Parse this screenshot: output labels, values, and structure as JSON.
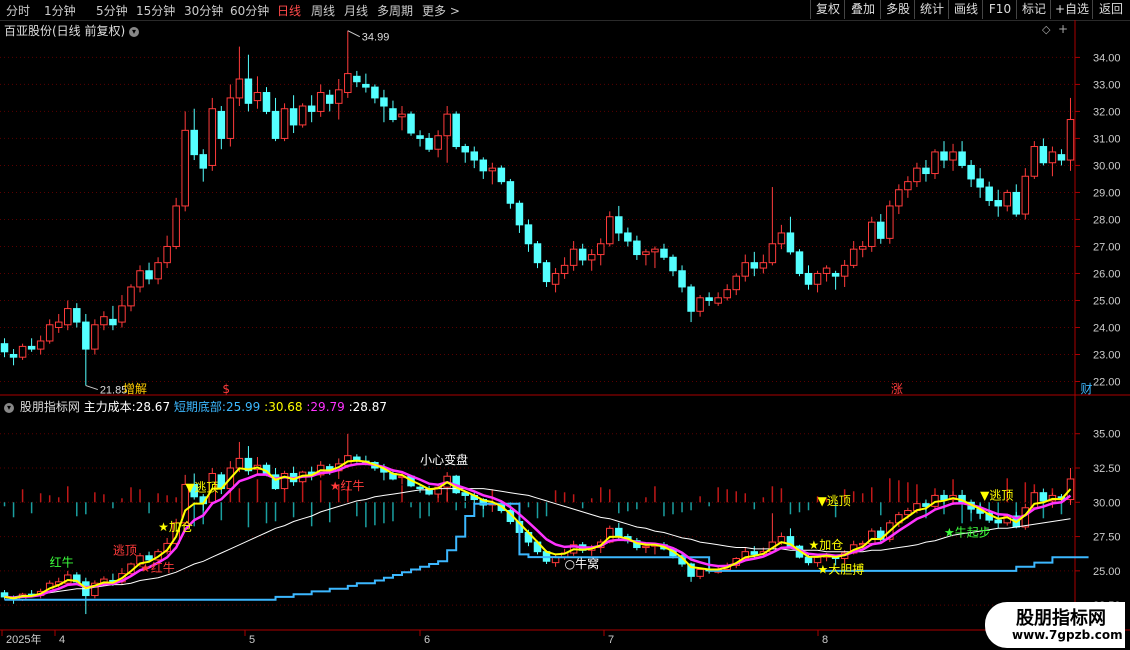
{
  "timeframes": [
    "分时",
    "1分钟",
    "5分钟",
    "15分钟",
    "30分钟",
    "60分钟",
    "日线",
    "周线",
    "月线",
    "多周期",
    "更多"
  ],
  "active_timeframe": "日线",
  "toolbar": [
    "复权",
    "叠加",
    "多股",
    "统计",
    "画线",
    "F10",
    "标记",
    "+自选",
    "返回"
  ],
  "stock_title": "百亚股份(日线 前复权)",
  "indicator": {
    "name": "股朋指标网",
    "main_cost_label": "主力成本:",
    "main_cost": "28.67",
    "short_bottom_label": "短期底部:",
    "short_bottom": "25.99",
    "v3": "30.68",
    "v4": "29.79",
    "v5": "28.87"
  },
  "k_yaxis": [
    "34.00",
    "33.00",
    "32.00",
    "31.00",
    "30.00",
    "29.00",
    "28.00",
    "27.00",
    "26.00",
    "25.00",
    "24.00",
    "23.00",
    "22.00"
  ],
  "ind_yaxis": [
    "35.00",
    "32.50",
    "30.00",
    "27.50",
    "25.00",
    "22.50"
  ],
  "high_label": "34.99",
  "low_label": "21.85",
  "events": [
    "增解",
    "$",
    "涨",
    "财"
  ],
  "annotations": [
    "逃顶",
    "逃顶",
    "加仓",
    "红牛",
    "红牛",
    "小心变盘",
    "牛窝",
    "逃顶",
    "加仓",
    "大胆搏",
    "牛起步",
    "逃顶",
    "红牛"
  ],
  "xaxis": [
    "2025年",
    "4",
    "5",
    "6",
    "7",
    "8"
  ],
  "watermark": {
    "name": "股朋指标网",
    "url": "www.7gpzb.com"
  },
  "colors": {
    "up": "#ff3b3b",
    "down": "#54ffff",
    "cost": "#ffffff",
    "bottom": "#3cb8ff",
    "yellow": "#ffff00",
    "magenta": "#ff33ff"
  },
  "chart_data": {
    "type": "candlestick",
    "ohlc": [
      [
        23.4,
        23.6,
        22.9,
        23.1
      ],
      [
        23.0,
        23.2,
        22.6,
        22.9
      ],
      [
        22.9,
        23.4,
        22.8,
        23.3
      ],
      [
        23.3,
        23.6,
        23.1,
        23.2
      ],
      [
        23.2,
        23.7,
        23.0,
        23.5
      ],
      [
        23.5,
        24.3,
        23.4,
        24.1
      ],
      [
        24.0,
        24.5,
        23.8,
        24.2
      ],
      [
        24.1,
        25.0,
        23.9,
        24.7
      ],
      [
        24.7,
        24.9,
        24.0,
        24.2
      ],
      [
        24.2,
        24.5,
        21.85,
        23.2
      ],
      [
        23.2,
        24.3,
        23.0,
        24.1
      ],
      [
        24.1,
        24.6,
        23.9,
        24.4
      ],
      [
        24.3,
        24.8,
        23.9,
        24.1
      ],
      [
        24.2,
        25.2,
        24.0,
        24.8
      ],
      [
        24.8,
        25.6,
        24.6,
        25.5
      ],
      [
        25.5,
        26.3,
        25.3,
        26.1
      ],
      [
        26.1,
        26.4,
        25.6,
        25.8
      ],
      [
        25.8,
        26.6,
        25.6,
        26.4
      ],
      [
        26.4,
        27.4,
        26.2,
        27.0
      ],
      [
        27.0,
        28.8,
        26.9,
        28.5
      ],
      [
        28.5,
        32.0,
        28.3,
        31.3
      ],
      [
        31.3,
        32.1,
        30.2,
        30.4
      ],
      [
        30.4,
        30.6,
        29.4,
        29.9
      ],
      [
        30.0,
        32.5,
        29.8,
        32.1
      ],
      [
        32.0,
        32.2,
        30.6,
        31.0
      ],
      [
        31.0,
        33.0,
        30.7,
        32.5
      ],
      [
        32.5,
        34.4,
        32.2,
        33.2
      ],
      [
        33.2,
        34.1,
        32.0,
        32.3
      ],
      [
        32.4,
        33.3,
        32.1,
        32.7
      ],
      [
        32.7,
        32.9,
        31.9,
        32.0
      ],
      [
        32.0,
        32.5,
        30.9,
        31.0
      ],
      [
        31.0,
        32.3,
        30.9,
        32.1
      ],
      [
        32.1,
        32.6,
        31.2,
        31.5
      ],
      [
        31.5,
        32.3,
        31.4,
        32.2
      ],
      [
        32.2,
        32.6,
        31.6,
        32.0
      ],
      [
        32.0,
        33.0,
        31.8,
        32.7
      ],
      [
        32.6,
        32.8,
        32.0,
        32.3
      ],
      [
        32.3,
        33.2,
        31.7,
        32.8
      ],
      [
        32.7,
        34.99,
        32.5,
        33.4
      ],
      [
        33.3,
        33.5,
        32.9,
        33.1
      ],
      [
        33.0,
        33.4,
        32.7,
        32.9
      ],
      [
        32.9,
        33.0,
        32.3,
        32.5
      ],
      [
        32.5,
        32.8,
        31.6,
        32.2
      ],
      [
        32.1,
        32.4,
        31.6,
        31.7
      ],
      [
        31.8,
        32.2,
        31.3,
        31.9
      ],
      [
        31.9,
        32.0,
        31.1,
        31.2
      ],
      [
        31.1,
        31.3,
        30.7,
        31.0
      ],
      [
        31.0,
        31.2,
        30.5,
        30.6
      ],
      [
        30.6,
        31.3,
        30.3,
        31.1
      ],
      [
        31.1,
        32.2,
        30.1,
        31.9
      ],
      [
        31.9,
        32.0,
        30.6,
        30.7
      ],
      [
        30.7,
        30.8,
        30.1,
        30.5
      ],
      [
        30.5,
        30.7,
        29.9,
        30.2
      ],
      [
        30.2,
        30.3,
        29.5,
        29.8
      ],
      [
        29.8,
        30.1,
        29.3,
        29.9
      ],
      [
        29.9,
        30.0,
        29.3,
        29.4
      ],
      [
        29.4,
        29.5,
        28.4,
        28.6
      ],
      [
        28.6,
        28.7,
        27.5,
        27.8
      ],
      [
        27.8,
        28.0,
        26.8,
        27.1
      ],
      [
        27.1,
        27.2,
        26.2,
        26.4
      ],
      [
        26.4,
        26.5,
        25.5,
        25.7
      ],
      [
        25.6,
        26.2,
        25.3,
        26.0
      ],
      [
        26.0,
        26.6,
        25.8,
        26.3
      ],
      [
        26.3,
        27.2,
        26.1,
        26.9
      ],
      [
        26.9,
        27.1,
        26.3,
        26.5
      ],
      [
        26.5,
        26.9,
        26.1,
        26.7
      ],
      [
        26.7,
        27.3,
        26.3,
        27.1
      ],
      [
        27.1,
        28.3,
        27.0,
        28.1
      ],
      [
        28.1,
        28.5,
        27.2,
        27.5
      ],
      [
        27.5,
        27.7,
        27.0,
        27.2
      ],
      [
        27.2,
        27.4,
        26.5,
        26.7
      ],
      [
        26.7,
        26.9,
        26.3,
        26.8
      ],
      [
        26.8,
        27.0,
        26.2,
        26.9
      ],
      [
        26.9,
        27.1,
        26.5,
        26.6
      ],
      [
        26.6,
        26.7,
        25.9,
        26.1
      ],
      [
        26.1,
        26.3,
        25.3,
        25.5
      ],
      [
        25.5,
        25.6,
        24.2,
        24.6
      ],
      [
        24.6,
        25.2,
        24.4,
        25.1
      ],
      [
        25.1,
        25.3,
        24.8,
        25.0
      ],
      [
        24.9,
        25.3,
        24.8,
        25.1
      ],
      [
        25.1,
        25.6,
        25.0,
        25.4
      ],
      [
        25.4,
        26.0,
        25.2,
        25.9
      ],
      [
        25.9,
        26.7,
        25.7,
        26.4
      ],
      [
        26.4,
        26.8,
        25.9,
        26.2
      ],
      [
        26.2,
        26.7,
        26.0,
        26.4
      ],
      [
        26.4,
        29.2,
        26.3,
        27.1
      ],
      [
        27.1,
        27.8,
        26.9,
        27.5
      ],
      [
        27.5,
        28.1,
        26.7,
        26.8
      ],
      [
        26.8,
        26.9,
        25.9,
        26.0
      ],
      [
        26.0,
        26.3,
        25.4,
        25.6
      ],
      [
        25.6,
        26.1,
        25.3,
        26.0
      ],
      [
        26.0,
        26.3,
        25.7,
        26.2
      ],
      [
        26.0,
        26.1,
        25.4,
        25.9
      ],
      [
        25.9,
        26.5,
        25.5,
        26.3
      ],
      [
        26.3,
        27.2,
        26.2,
        26.9
      ],
      [
        26.9,
        27.2,
        26.6,
        27.0
      ],
      [
        27.0,
        28.1,
        26.8,
        27.9
      ],
      [
        27.9,
        28.2,
        27.1,
        27.3
      ],
      [
        27.3,
        28.7,
        27.1,
        28.5
      ],
      [
        28.5,
        29.3,
        28.2,
        29.1
      ],
      [
        29.1,
        29.6,
        28.8,
        29.4
      ],
      [
        29.4,
        30.1,
        29.2,
        29.9
      ],
      [
        29.9,
        30.2,
        29.4,
        29.7
      ],
      [
        29.7,
        30.6,
        29.5,
        30.5
      ],
      [
        30.5,
        30.9,
        29.9,
        30.2
      ],
      [
        30.2,
        30.8,
        29.8,
        30.5
      ],
      [
        30.5,
        30.9,
        29.9,
        30.0
      ],
      [
        30.0,
        30.2,
        29.2,
        29.5
      ],
      [
        29.5,
        29.9,
        28.8,
        29.2
      ],
      [
        29.2,
        29.4,
        28.5,
        28.7
      ],
      [
        28.7,
        29.1,
        28.1,
        28.5
      ],
      [
        28.5,
        29.1,
        28.3,
        29.0
      ],
      [
        29.0,
        29.3,
        28.1,
        28.2
      ],
      [
        28.2,
        29.9,
        28.0,
        29.6
      ],
      [
        29.6,
        30.9,
        29.5,
        30.7
      ],
      [
        30.7,
        31.0,
        30.0,
        30.1
      ],
      [
        30.1,
        30.7,
        29.6,
        30.5
      ],
      [
        30.4,
        30.6,
        30.0,
        30.2
      ],
      [
        30.2,
        32.5,
        29.8,
        31.7
      ]
    ],
    "main_cost": [
      23.1,
      23.1,
      23.2,
      23.2,
      23.3,
      23.4,
      23.5,
      23.6,
      23.7,
      23.7,
      23.8,
      23.9,
      24.0,
      24.0,
      24.1,
      24.3,
      24.4,
      24.5,
      24.7,
      24.9,
      25.2,
      25.5,
      25.7,
      26.0,
      26.3,
      26.6,
      26.9,
      27.2,
      27.5,
      27.8,
      28.1,
      28.3,
      28.6,
      28.8,
      29.0,
      29.3,
      29.5,
      29.7,
      29.9,
      30.1,
      30.2,
      30.4,
      30.5,
      30.6,
      30.7,
      30.8,
      30.9,
      30.9,
      31.0,
      31.0,
      31.0,
      31.0,
      31.0,
      31.0,
      30.9,
      30.8,
      30.7,
      30.6,
      30.5,
      30.3,
      30.1,
      29.9,
      29.7,
      29.5,
      29.3,
      29.1,
      28.9,
      28.8,
      28.6,
      28.4,
      28.2,
      28.1,
      27.9,
      27.8,
      27.6,
      27.4,
      27.3,
      27.1,
      27.0,
      26.9,
      26.8,
      26.7,
      26.7,
      26.6,
      26.6,
      26.6,
      26.6,
      26.5,
      26.5,
      26.5,
      26.5,
      26.4,
      26.4,
      26.4,
      26.4,
      26.4,
      26.5,
      26.5,
      26.6,
      26.7,
      26.8,
      26.9,
      27.1,
      27.2,
      27.4,
      27.6,
      27.7,
      27.8,
      27.9,
      28.0,
      28.1,
      28.1,
      28.2,
      28.3,
      28.4,
      28.5,
      28.6,
      28.7,
      28.8
    ],
    "short_bottom": [
      22.9,
      22.9,
      22.9,
      22.9,
      22.9,
      22.9,
      22.9,
      22.9,
      22.9,
      22.9,
      22.9,
      22.9,
      22.9,
      22.9,
      22.9,
      22.9,
      22.9,
      22.9,
      22.9,
      22.9,
      22.9,
      22.9,
      22.9,
      22.9,
      22.9,
      22.9,
      22.9,
      22.9,
      22.9,
      22.9,
      23.1,
      23.1,
      23.3,
      23.3,
      23.5,
      23.5,
      23.7,
      23.7,
      23.9,
      24.1,
      24.1,
      24.3,
      24.5,
      24.7,
      24.9,
      25.1,
      25.3,
      25.5,
      25.7,
      26.5,
      27.5,
      29.0,
      29.9,
      29.9,
      29.9,
      29.9,
      29.9,
      26.2,
      26.0,
      26.0,
      26.0,
      25.99,
      25.99,
      25.99,
      25.99,
      25.99,
      25.99,
      25.99,
      25.99,
      25.99,
      25.99,
      25.99,
      25.99,
      25.99,
      25.99,
      25.99,
      25.99,
      25.99,
      25.0,
      25.0,
      25.0,
      25.0,
      25.0,
      25.0,
      25.0,
      25.0,
      25.0,
      25.0,
      25.0,
      25.0,
      25.0,
      25.0,
      25.0,
      25.0,
      25.0,
      25.0,
      25.0,
      25.0,
      25.0,
      25.0,
      25.0,
      25.0,
      25.0,
      25.0,
      25.0,
      25.0,
      25.0,
      25.0,
      25.0,
      25.0,
      25.0,
      25.0,
      25.3,
      25.3,
      25.6,
      25.6,
      25.99,
      25.99,
      25.99,
      25.99,
      25.99
    ],
    "ylim_k": [
      21.5,
      35.2
    ],
    "ylim_ind": [
      22.0,
      36.0
    ]
  }
}
